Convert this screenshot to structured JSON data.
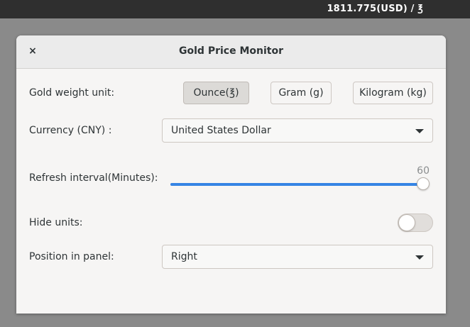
{
  "panel": {
    "price_text": "1811.775(USD) / ℥"
  },
  "dialog": {
    "title": "Gold Price Monitor",
    "close_glyph": "×",
    "close_icon": "close-icon"
  },
  "weight_unit": {
    "label": "Gold weight unit:",
    "options": [
      {
        "label": "Ounce(℥)",
        "selected": true
      },
      {
        "label": "Gram (g)",
        "selected": false
      },
      {
        "label": "Kilogram (kg)",
        "selected": false
      }
    ]
  },
  "currency": {
    "label": "Currency (CNY) :",
    "value": "United States Dollar",
    "icon": "chevron-down-icon"
  },
  "refresh": {
    "label": "Refresh interval(Minutes):",
    "value": "60",
    "min": 0,
    "max": 60
  },
  "hide_units": {
    "label": "Hide units:",
    "on": false
  },
  "position": {
    "label": "Position in panel:",
    "value": "Right",
    "icon": "chevron-down-icon"
  },
  "colors": {
    "accent": "#3584e4",
    "topbar": "#2f2f2f",
    "dialog_bg": "#f6f5f4"
  }
}
